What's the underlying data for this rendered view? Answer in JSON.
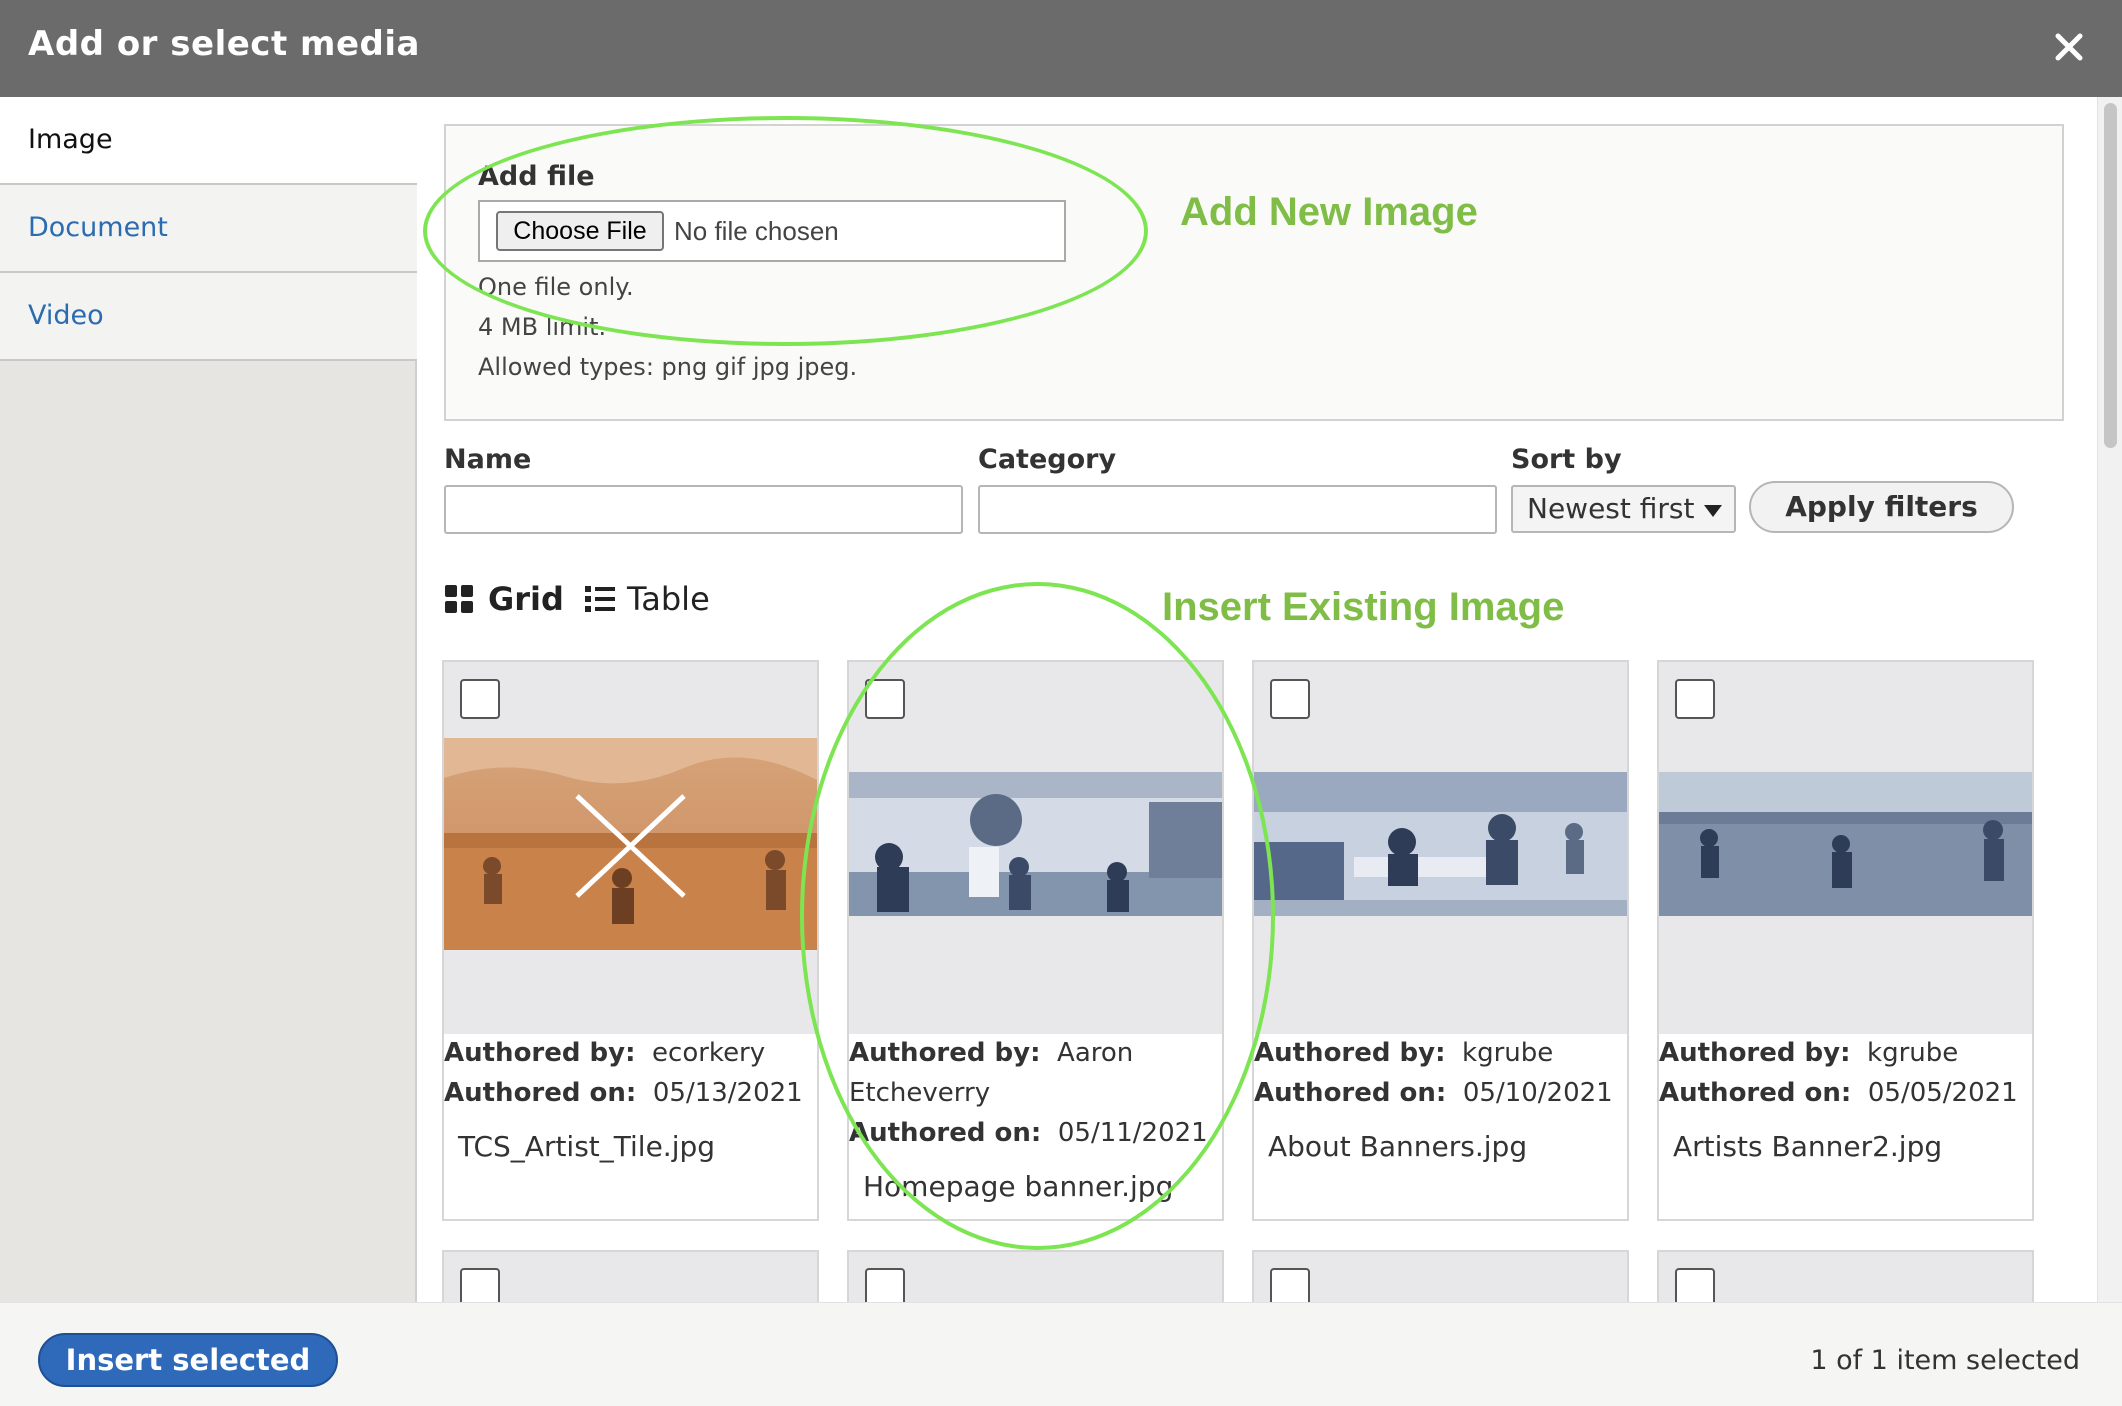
{
  "dialog": {
    "title": "Add or select media",
    "close_icon": "close-icon"
  },
  "sidebar": {
    "tabs": [
      {
        "label": "Image",
        "active": true
      },
      {
        "label": "Document"
      },
      {
        "label": "Video"
      }
    ]
  },
  "upload": {
    "label": "Add file",
    "choose_button": "Choose File",
    "no_file": "No file chosen",
    "help": [
      "One file only.",
      "4 MB limit.",
      "Allowed types: png gif jpg jpeg."
    ]
  },
  "annotations": {
    "add_new": "Add New Image",
    "insert_existing": "Insert Existing Image",
    "color": "#7fbd46"
  },
  "filters": {
    "name_label": "Name",
    "name_value": "",
    "category_label": "Category",
    "category_value": "",
    "sort_label": "Sort by",
    "sort_value": "Newest first",
    "apply_button": "Apply filters"
  },
  "views": {
    "grid": "Grid",
    "table": "Table"
  },
  "cards": [
    {
      "authored_by_label": "Authored by:",
      "author": "ecorkery",
      "authored_on_label": "Authored on:",
      "date": "05/13/2021",
      "filename": "TCS_Artist_Tile.jpg"
    },
    {
      "authored_by_label": "Authored by:",
      "author": "Aaron",
      "author_line2": "Etcheverry",
      "authored_on_label": "Authored on:",
      "date": "05/11/2021",
      "filename": "Homepage banner.jpg"
    },
    {
      "authored_by_label": "Authored by:",
      "author": "kgrube",
      "authored_on_label": "Authored on:",
      "date": "05/10/2021",
      "filename": "About Banners.jpg"
    },
    {
      "authored_by_label": "Authored by:",
      "author": "kgrube",
      "authored_on_label": "Authored on:",
      "date": "05/05/2021",
      "filename": "Artists Banner2.jpg"
    }
  ],
  "footer": {
    "insert_button": "Insert selected",
    "selection_status": "1 of 1 item selected"
  }
}
